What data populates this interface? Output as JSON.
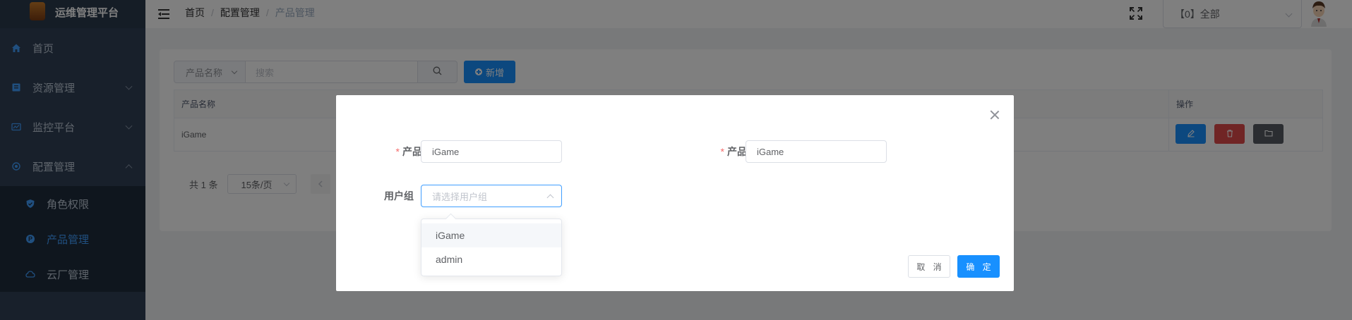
{
  "app": {
    "title": "运维管理平台"
  },
  "sidebar": {
    "items": [
      {
        "label": "首页",
        "icon": "home-icon"
      },
      {
        "label": "资源管理",
        "icon": "resource-icon"
      },
      {
        "label": "监控平台",
        "icon": "monitor-icon"
      },
      {
        "label": "配置管理",
        "icon": "config-icon"
      }
    ],
    "subitems": [
      {
        "label": "角色权限",
        "icon": "shield-icon"
      },
      {
        "label": "产品管理",
        "icon": "product-icon"
      },
      {
        "label": "云厂管理",
        "icon": "cloud-icon"
      }
    ]
  },
  "header": {
    "breadcrumb": [
      "首页",
      "配置管理",
      "产品管理"
    ],
    "scope_select_value": "【0】全部"
  },
  "toolbar": {
    "search_field_select": "产品名称",
    "search_placeholder": "搜索",
    "add_label": "新增"
  },
  "table": {
    "columns": [
      "产品名称",
      "操作"
    ],
    "rows": [
      {
        "name": "iGame"
      }
    ]
  },
  "pagination": {
    "total_text": "共 1 条",
    "page_size": "15条/页"
  },
  "modal": {
    "fields": {
      "product_name_label": "产品名称",
      "product_name_value": "iGame",
      "product_desc_label": "产品描述",
      "product_desc_value": "iGame",
      "user_group_label": "用户组",
      "user_group_placeholder": "请选择用户组"
    },
    "required_mark": "*",
    "dropdown_options": [
      "iGame",
      "admin"
    ],
    "cancel_label": "取 消",
    "ok_label": "确 定"
  },
  "colors": {
    "primary": "#1890ff",
    "danger": "#e04a4a",
    "dark": "#565b62",
    "sidebar_bg": "#304156",
    "active_text": "#409eff",
    "required": "#f56c6c"
  }
}
